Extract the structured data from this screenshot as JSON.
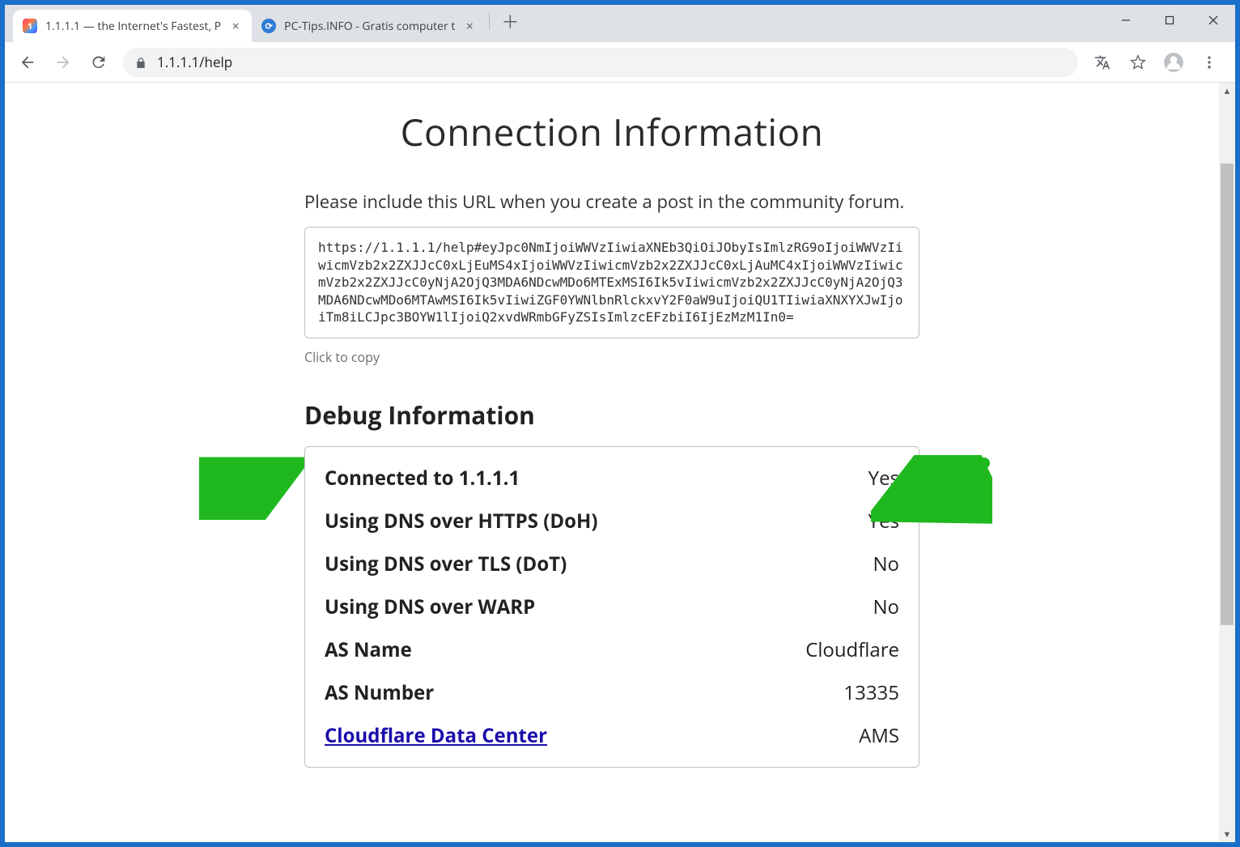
{
  "window": {
    "tabs": [
      {
        "title": "1.1.1.1 — the Internet's Fastest, P",
        "favicon": "1111",
        "active": true
      },
      {
        "title": "PC-Tips.INFO - Gratis computer t",
        "favicon": "pctips",
        "active": false
      }
    ],
    "url": "1.1.1.1/help"
  },
  "toolbar_icons": {
    "back": "back-icon",
    "forward": "forward-icon",
    "reload": "reload-icon",
    "translate": "translate-icon",
    "star": "star-icon",
    "profile": "profile-icon",
    "menu": "menu-icon"
  },
  "page": {
    "title": "Connection Information",
    "instruction": "Please include this URL when you create a post in the community forum.",
    "share_url": "https://1.1.1.1/help#eyJpc0NmIjoiWWVzIiwiaXNEb3QiOiJObyIsImlzRG9oIjoiWWVzIiwicmVzb2x2ZXJJcC0xLjEuMS4xIjoiWWVzIiwicmVzb2x2ZXJJcC0xLjAuMC4xIjoiWWVzIiwicmVzb2x2ZXJJcC0yNjA2OjQ3MDA6NDcwMDo6MTExMSI6Ik5vIiwicmVzb2x2ZXJJcC0yNjA2OjQ3MDA6NDcwMDo6MTAwMSI6Ik5vIiwiZGF0YWNlbnRlckxvY2F0aW9uIjoiQU1TIiwiaXNXYXJwIjoiTm8iLCJpc3BOYW1lIjoiQ2xvdWRmbGFyZSIsImlzcEFzbiI6IjEzMzM1In0=",
    "click_copy": "Click to copy",
    "debug_title": "Debug Information",
    "debug_rows": [
      {
        "label": "Connected to 1.1.1.1",
        "value": "Yes",
        "link": false
      },
      {
        "label": "Using DNS over HTTPS (DoH)",
        "value": "Yes",
        "link": false
      },
      {
        "label": "Using DNS over TLS (DoT)",
        "value": "No",
        "link": false
      },
      {
        "label": "Using DNS over WARP",
        "value": "No",
        "link": false
      },
      {
        "label": "AS Name",
        "value": "Cloudflare",
        "link": false
      },
      {
        "label": "AS Number",
        "value": "13335",
        "link": false
      },
      {
        "label": "Cloudflare Data Center",
        "value": "AMS",
        "link": true
      }
    ]
  },
  "annotation": {
    "left_arrow_color": "#1fb81f",
    "right_arrow_color": "#1fb81f"
  }
}
